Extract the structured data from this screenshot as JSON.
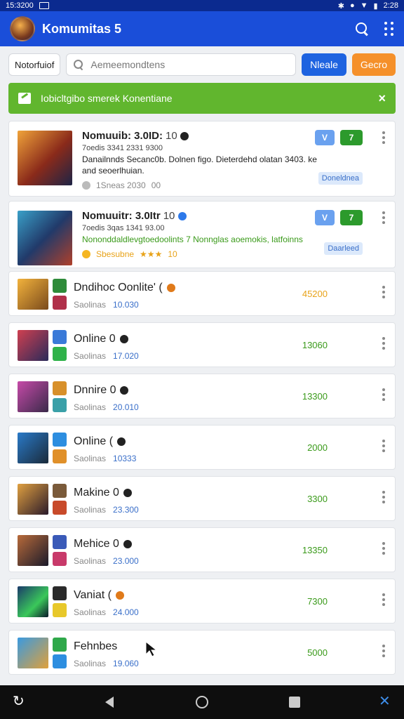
{
  "status": {
    "time_left": "15:3200",
    "time_right": "2:28"
  },
  "appbar": {
    "title": "Komumitas 5"
  },
  "filter": {
    "chip": "Notorfuiof",
    "search_placeholder": "Aemeemondtens",
    "btn_blue": "Nleale",
    "btn_orange": "Gecro"
  },
  "banner": {
    "text": "Iobicltgibo smerek Konentiane",
    "close": "×"
  },
  "featured": [
    {
      "title": "Nomuuib: 3.0ID:",
      "num": "10",
      "sub": "7oedis 3341 2331 9300",
      "desc": "Danailnnds Secanc0b. Dolnen figo. Dieterdehd olatan 3403. ke and seoerlhuian.",
      "desc_color": "dark",
      "meta": "1Sneas 2030",
      "meta2": "00",
      "pill_v": "V",
      "pill_g": "7",
      "tag": "Doneldnea"
    },
    {
      "title": "Nomuuitr: 3.0Itr",
      "num": "10",
      "sub": "7oedis 3qas 1341 93.00",
      "desc": "Nononddaldlevgtoedoolints 7 Nonnglas aoemokis, latfoinns",
      "desc_color": "green",
      "meta": "Sbesubne",
      "meta2": "10",
      "pill_v": "V",
      "pill_g": "7",
      "tag": "Daarleed"
    }
  ],
  "items": [
    {
      "title": "Dndihoc Oonlite' (",
      "sub": "Saolinas",
      "val": "10.030",
      "price": "45200",
      "price_color": "orange"
    },
    {
      "title": "Online 0",
      "sub": "Saolinas",
      "val": "17.020",
      "price": "13060",
      "price_color": "green"
    },
    {
      "title": "Dnnire 0",
      "sub": "Saolinas",
      "val": "20.010",
      "price": "13300",
      "price_color": "green"
    },
    {
      "title": "Online (",
      "sub": "Saolinas",
      "val": "10333",
      "price": "2000",
      "price_color": "green"
    },
    {
      "title": "Makine 0",
      "sub": "Saolinas",
      "val": "23.300",
      "price": "3300",
      "price_color": "green"
    },
    {
      "title": "Mehice 0",
      "sub": "Saolinas",
      "val": "23.000",
      "price": "13350",
      "price_color": "green"
    },
    {
      "title": "Vaniat (",
      "sub": "Saolinas",
      "val": "24.000",
      "price": "7300",
      "price_color": "green"
    },
    {
      "title": "Fehnbes",
      "sub": "Saolinas",
      "val": "19.060",
      "price": "5000",
      "price_color": "green"
    }
  ]
}
